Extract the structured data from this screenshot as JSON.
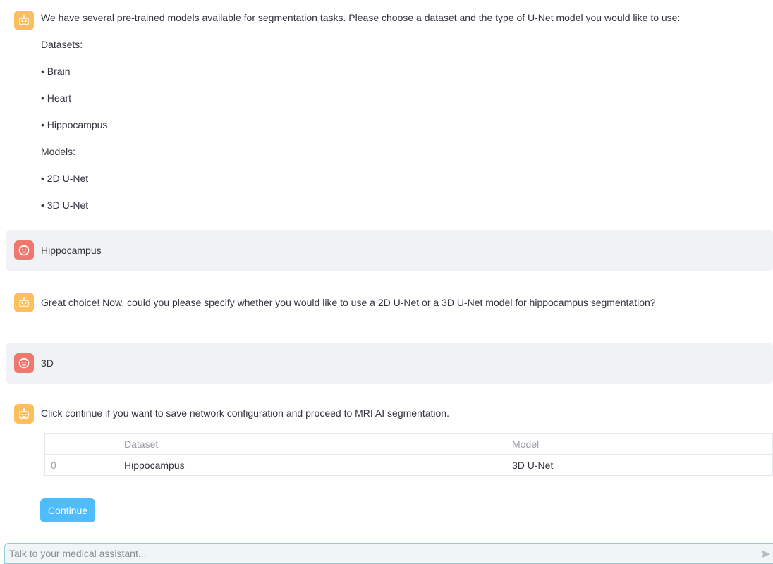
{
  "messages": [
    {
      "role": "assistant",
      "intro": "We have several pre-trained models available for segmentation tasks. Please choose a dataset and the type of U-Net model you would like to use:",
      "datasets_heading": "Datasets:",
      "datasets": [
        "• Brain",
        "• Heart",
        "• Hippocampus"
      ],
      "models_heading": "Models:",
      "models": [
        "• 2D U-Net",
        "• 3D U-Net"
      ]
    },
    {
      "role": "user",
      "text": "Hippocampus"
    },
    {
      "role": "assistant",
      "text": "Great choice! Now, could you please specify whether you would like to use a 2D U-Net or a 3D U-Net model for hippocampus segmentation?"
    },
    {
      "role": "user",
      "text": "3D"
    },
    {
      "role": "assistant",
      "text": "Click continue if you want to save network configuration and proceed to MRI AI segmentation."
    }
  ],
  "table": {
    "columns": [
      "",
      "Dataset",
      "Model"
    ],
    "rows": [
      [
        "0",
        "Hippocampus",
        "3D U-Net"
      ]
    ]
  },
  "continue_label": "Continue",
  "chat_input": {
    "placeholder": "Talk to your medical assistant..."
  },
  "icons": {
    "assistant_avatar": "robot-face-icon",
    "user_avatar": "smiley-face-icon",
    "send": "send-arrow-icon"
  },
  "colors": {
    "assistant_avatar": "#fdbf5b",
    "user_avatar": "#f0776e",
    "button": "#4fbdfb",
    "user_message_bg": "#f0f2f6"
  }
}
